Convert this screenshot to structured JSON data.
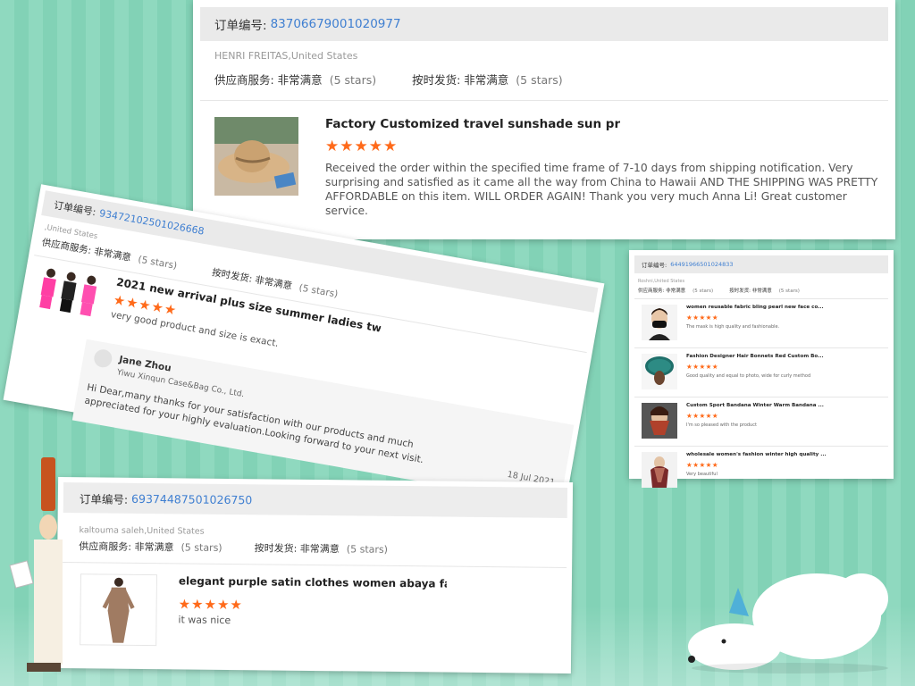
{
  "reviews": [
    {
      "order_label": "订单编号:",
      "order_no": "83706679001020977",
      "buyer": "HENRI FREITAS,United States",
      "supplier_service_label": "供应商服务: 非常满意",
      "supplier_service_stars": "(5 stars)",
      "on_time_label": "按时发货: 非常满意",
      "on_time_stars": "(5 stars)",
      "product_title": "Factory Customized travel sunshade sun prote...",
      "rating": 5,
      "stars": "★★★★★",
      "comment": "Received the order within the specified time frame of 7-10 days from shipping notification. Very surprising and satisfied as it came all the way from China to Hawaii AND THE SHIPPING WAS PRETTY AFFORDABLE on this item. WILL ORDER AGAIN! Thank you very much Anna Li! Great customer service."
    },
    {
      "order_label": "订单编号:",
      "order_no": "93472102501026668",
      "buyer": ",United States",
      "supplier_service_label": "供应商服务: 非常满意",
      "supplier_service_stars": "(5 stars)",
      "on_time_label": "按时发货: 非常满意",
      "on_time_stars": "(5 stars)",
      "product_title": "2021 new arrival plus size summer ladies two ...",
      "rating": 5,
      "stars": "★★★★★",
      "comment": "very good product and size is exact.",
      "reply": {
        "name": "Jane Zhou",
        "company": "Yiwu Xinqun Case&Bag Co., Ltd.",
        "text": "Hi Dear,many thanks for your satisfaction with our products and much appreciated for your highly evaluation.Looking forward to your next visit.",
        "date": "18 Jul 2021"
      }
    },
    {
      "order_label": "订单编号:",
      "order_no": "64491966501024833",
      "buyer": "Roshni,United States",
      "supplier_service_label": "供应商服务: 非常满意",
      "supplier_service_stars": "(5 stars)",
      "on_time_label": "按时发货: 非常满意",
      "on_time_stars": "(5 stars)",
      "items": [
        {
          "product_title": "women reusable fabric bling pearl new face co...",
          "rating": 5,
          "stars": "★★★★★",
          "comment": "The mask is high quality and fashionable.",
          "thumb_icon": "face-mask-model-photo"
        },
        {
          "product_title": "Fashion Designer Hair Bonnets Red Custom Bo...",
          "rating": 5,
          "stars": "★★★★★",
          "comment": "Good quality and equal to photo, wide for curly method",
          "thumb_icon": "hair-bonnet-photo"
        },
        {
          "product_title": "Custom Sport Bandana Winter Warm Bandana ...",
          "rating": 5,
          "stars": "★★★★★",
          "comment": "I'm so pleased with the product",
          "thumb_icon": "bandana-model-photo"
        },
        {
          "product_title": "wholesale women's fashion winter high quality ...",
          "rating": 5,
          "stars": "★★★★★",
          "comment": "Very beautiful",
          "thumb_icon": "winter-scarf-photo"
        }
      ]
    },
    {
      "order_label": "订单编号:",
      "order_no": "69374487501026750",
      "buyer": "kaltouma saleh,United States",
      "supplier_service_label": "供应商服务: 非常满意",
      "supplier_service_stars": "(5 stars)",
      "on_time_label": "按时发货: 非常满意",
      "on_time_stars": "(5 stars)",
      "product_title": "elegant purple satin clothes women abaya fanc...",
      "rating": 5,
      "stars": "★★★★★",
      "comment": "it was nice"
    }
  ],
  "colors": {
    "background": "#8fd9bf",
    "order_link": "#3f7fd1",
    "star": "#ff6a1a",
    "bar": "#eaeaea"
  },
  "icons": [
    "straw-hat-photo",
    "outfit-models-photo",
    "abaya-dress-photo",
    "cartoon-chef-decoration",
    "polar-bear-decoration"
  ]
}
